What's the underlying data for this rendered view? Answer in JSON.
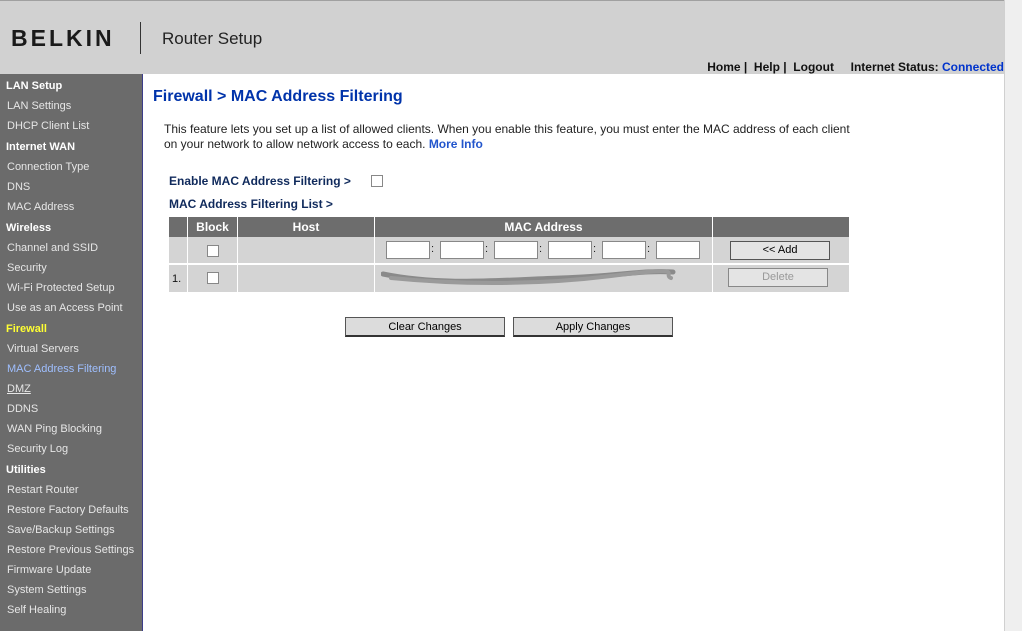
{
  "header": {
    "logo": "BELKIN",
    "title": "Router Setup",
    "links": [
      "Home",
      "Help",
      "Logout"
    ],
    "status_label": "Internet Status:",
    "status_value": "Connected"
  },
  "sidebar": {
    "sections": [
      {
        "title": "LAN Setup",
        "items": [
          "LAN Settings",
          "DHCP Client List"
        ]
      },
      {
        "title": "Internet WAN",
        "items": [
          "Connection Type",
          "DNS",
          "MAC Address"
        ]
      },
      {
        "title": "Wireless",
        "items": [
          "Channel and SSID",
          "Security",
          "Wi-Fi Protected Setup",
          "Use as an Access Point"
        ]
      },
      {
        "title": "Firewall",
        "items": [
          "Virtual Servers",
          "MAC Address Filtering",
          "DMZ",
          "DDNS",
          "WAN Ping Blocking",
          "Security Log"
        ]
      },
      {
        "title": "Utilities",
        "items": [
          "Restart Router",
          "Restore Factory Defaults",
          "Save/Backup Settings",
          "Restore Previous Settings",
          "Firmware Update",
          "System Settings",
          "Self Healing"
        ]
      }
    ]
  },
  "main": {
    "page_title": "Firewall > MAC Address Filtering",
    "description": "This feature lets you set up a list of allowed clients. When you enable this feature, you must enter the MAC address of each client on your network to allow network access to each.",
    "more_info": "More Info",
    "enable_label": "Enable MAC Address Filtering >",
    "enable_checked": false,
    "list_label": "MAC Address Filtering List >",
    "table": {
      "columns": [
        "Block",
        "Host",
        "MAC Address"
      ],
      "add_label": "<< Add",
      "delete_label": "Delete",
      "rows": [
        {
          "num": "1."
        }
      ]
    },
    "buttons": {
      "clear": "Clear Changes",
      "apply": "Apply Changes"
    }
  }
}
